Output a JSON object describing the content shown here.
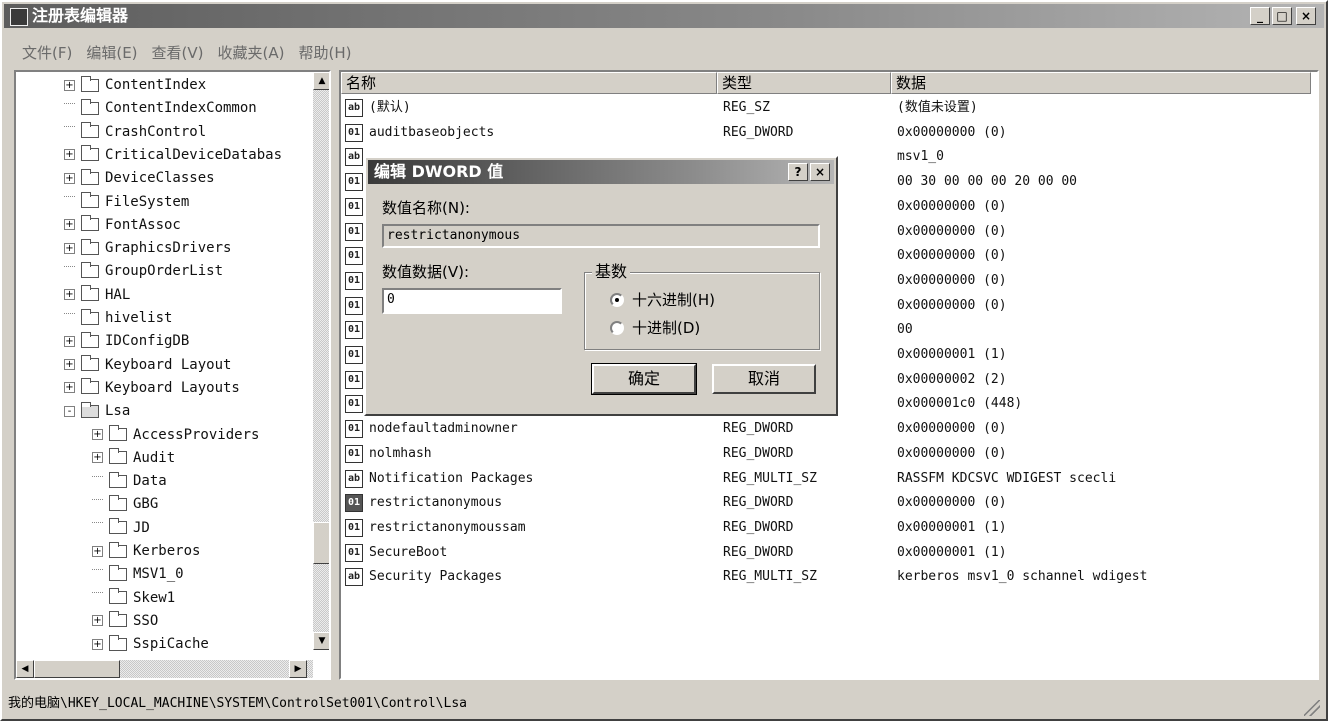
{
  "window": {
    "title": "注册表编辑器",
    "min_label": "_",
    "max_label": "□",
    "close_label": "×"
  },
  "menu": [
    "文件(F)",
    "编辑(E)",
    "查看(V)",
    "收藏夹(A)",
    "帮助(H)"
  ],
  "tree": [
    {
      "label": "ContentIndex",
      "level": 0,
      "expander": "+"
    },
    {
      "label": "ContentIndexCommon",
      "level": 0,
      "expander": ""
    },
    {
      "label": "CrashControl",
      "level": 0,
      "expander": ""
    },
    {
      "label": "CriticalDeviceDatabas",
      "level": 0,
      "expander": "+"
    },
    {
      "label": "DeviceClasses",
      "level": 0,
      "expander": "+"
    },
    {
      "label": "FileSystem",
      "level": 0,
      "expander": ""
    },
    {
      "label": "FontAssoc",
      "level": 0,
      "expander": "+"
    },
    {
      "label": "GraphicsDrivers",
      "level": 0,
      "expander": "+"
    },
    {
      "label": "GroupOrderList",
      "level": 0,
      "expander": ""
    },
    {
      "label": "HAL",
      "level": 0,
      "expander": "+"
    },
    {
      "label": "hivelist",
      "level": 0,
      "expander": ""
    },
    {
      "label": "IDConfigDB",
      "level": 0,
      "expander": "+"
    },
    {
      "label": "Keyboard Layout",
      "level": 0,
      "expander": "+"
    },
    {
      "label": "Keyboard Layouts",
      "level": 0,
      "expander": "+"
    },
    {
      "label": "Lsa",
      "level": 0,
      "expander": "-",
      "open": true
    },
    {
      "label": "AccessProviders",
      "level": 1,
      "expander": "+"
    },
    {
      "label": "Audit",
      "level": 1,
      "expander": "+"
    },
    {
      "label": "Data",
      "level": 1,
      "expander": ""
    },
    {
      "label": "GBG",
      "level": 1,
      "expander": ""
    },
    {
      "label": "JD",
      "level": 1,
      "expander": ""
    },
    {
      "label": "Kerberos",
      "level": 1,
      "expander": "+"
    },
    {
      "label": "MSV1_0",
      "level": 1,
      "expander": ""
    },
    {
      "label": "Skew1",
      "level": 1,
      "expander": ""
    },
    {
      "label": "SSO",
      "level": 1,
      "expander": "+"
    },
    {
      "label": "SspiCache",
      "level": 1,
      "expander": "+"
    }
  ],
  "list": {
    "headers": [
      "名称",
      "类型",
      "数据"
    ],
    "rows": [
      {
        "icon": "ab",
        "name": "(默认)",
        "type": "REG_SZ",
        "data": "(数值未设置)"
      },
      {
        "icon": "dw",
        "name": "auditbaseobjects",
        "type": "REG_DWORD",
        "data": "0x00000000 (0)"
      },
      {
        "icon": "ab",
        "name": "",
        "type": "",
        "data": "msv1_0"
      },
      {
        "icon": "dw",
        "name": "",
        "type": "",
        "data": "00 30 00 00 00 20 00 00"
      },
      {
        "icon": "dw",
        "name": "",
        "type": "",
        "data": "0x00000000 (0)"
      },
      {
        "icon": "dw",
        "name": "",
        "type": "",
        "data": "0x00000000 (0)"
      },
      {
        "icon": "dw",
        "name": "",
        "type": "",
        "data": "0x00000000 (0)"
      },
      {
        "icon": "dw",
        "name": "",
        "type": "",
        "data": "0x00000000 (0)"
      },
      {
        "icon": "dw",
        "name": "",
        "type": "",
        "data": "0x00000000 (0)"
      },
      {
        "icon": "dw",
        "name": "",
        "type": "",
        "data": "00"
      },
      {
        "icon": "dw",
        "name": "",
        "type": "",
        "data": "0x00000001 (1)"
      },
      {
        "icon": "dw",
        "name": "",
        "type": "",
        "data": "0x00000002 (2)"
      },
      {
        "icon": "dw",
        "name": "",
        "type": "",
        "data": "0x000001c0 (448)"
      },
      {
        "icon": "dw",
        "name": "nodefaultadminowner",
        "type": "REG_DWORD",
        "data": "0x00000000 (0)"
      },
      {
        "icon": "dw",
        "name": "nolmhash",
        "type": "REG_DWORD",
        "data": "0x00000000 (0)"
      },
      {
        "icon": "ab",
        "name": "Notification Packages",
        "type": "REG_MULTI_SZ",
        "data": "RASSFM KDCSVC WDIGEST scecli"
      },
      {
        "icon": "dw",
        "name": "restrictanonymous",
        "type": "REG_DWORD",
        "data": "0x00000000 (0)",
        "selected": true
      },
      {
        "icon": "dw",
        "name": "restrictanonymoussam",
        "type": "REG_DWORD",
        "data": "0x00000001 (1)"
      },
      {
        "icon": "dw",
        "name": "SecureBoot",
        "type": "REG_DWORD",
        "data": "0x00000001 (1)"
      },
      {
        "icon": "ab",
        "name": "Security Packages",
        "type": "REG_MULTI_SZ",
        "data": "kerberos msv1_0 schannel wdigest"
      }
    ]
  },
  "status": {
    "path": "我的电脑\\HKEY_LOCAL_MACHINE\\SYSTEM\\ControlSet001\\Control\\Lsa"
  },
  "dialog": {
    "title": "编辑 DWORD 值",
    "help_label": "?",
    "close_label": "×",
    "name_label": "数值名称(N):",
    "name_value": "restrictanonymous",
    "data_label": "数值数据(V):",
    "data_value": "0",
    "base_label": "基数",
    "hex_label": "十六进制(H)",
    "dec_label": "十进制(D)",
    "base_selected": "hex",
    "ok_label": "确定",
    "cancel_label": "取消"
  }
}
